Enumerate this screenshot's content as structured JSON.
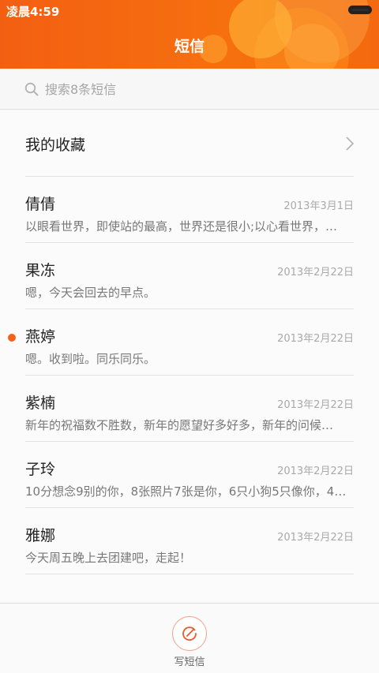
{
  "status_bar": {
    "time": "凌晨4:59"
  },
  "header": {
    "title": "短信",
    "accent_color": "#f4680f"
  },
  "search": {
    "placeholder": "搜索8条短信"
  },
  "favorites": {
    "label": "我的收藏"
  },
  "messages": [
    {
      "name": "倩倩",
      "date": "2013年3月1日",
      "preview": "以眼看世界，即使站的最高，世界还是很小;以心看世界，…",
      "unread": false
    },
    {
      "name": "果冻",
      "date": "2013年2月22日",
      "preview": "嗯，今天会回去的早点。",
      "unread": false
    },
    {
      "name": "燕婷",
      "date": "2013年2月22日",
      "preview": "嗯。收到啦。同乐同乐。",
      "unread": true
    },
    {
      "name": "紫楠",
      "date": "2013年2月22日",
      "preview": "新年的祝福数不胜数，新年的愿望好多好多，新年的问候…",
      "unread": false
    },
    {
      "name": "子玲",
      "date": "2013年2月22日",
      "preview": "10分想念9别的你，8张照片7张是你，6只小狗5只像你，4…",
      "unread": false
    },
    {
      "name": "雅娜",
      "date": "2013年2月22日",
      "preview": "今天周五晚上去团建吧，走起！",
      "unread": false
    }
  ],
  "bottom_bar": {
    "compose_label": "写短信",
    "unread_color": "#f4611a"
  }
}
